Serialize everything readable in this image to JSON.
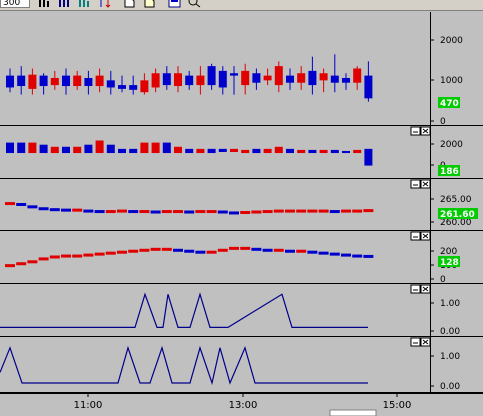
{
  "toolbar": {
    "input_value": "300",
    "buttons": [
      "bar-chart-icon",
      "volume-chart-icon",
      "stats-chart-icon",
      "sort-icon",
      "open-icon",
      "export-icon",
      "settings-icon",
      "zoom-icon"
    ]
  },
  "colors": {
    "background": "#c0c0c0",
    "up": "#e00000",
    "down": "#0000cc",
    "line": "#00008b",
    "badge": "#00cc00"
  },
  "x_axis": {
    "ticks": [
      "11:00",
      "13:00",
      "15:00"
    ]
  },
  "panels": [
    {
      "id": "price",
      "y_ticks": [
        "2000",
        "1000",
        "0"
      ],
      "badge": "470",
      "has_controls": false
    },
    {
      "id": "volume",
      "y_ticks": [
        "2000",
        "0"
      ],
      "badge": "186",
      "has_controls": true
    },
    {
      "id": "indicator1",
      "y_ticks": [
        "265.00",
        "260.00"
      ],
      "badge": "261.60",
      "has_controls": true
    },
    {
      "id": "indicator2",
      "y_ticks": [
        "200",
        "100",
        "0"
      ],
      "badge": "128",
      "has_controls": true
    },
    {
      "id": "signal1",
      "y_ticks": [
        "1.00",
        "0.00"
      ],
      "badge": "",
      "has_controls": true
    },
    {
      "id": "signal2",
      "y_ticks": [
        "1.00",
        "0.00"
      ],
      "badge": "",
      "has_controls": true
    }
  ],
  "chart_data": [
    {
      "type": "candlestick",
      "panel": "price",
      "ylim": [
        0,
        2300
      ],
      "candles": [
        {
          "o": 1000,
          "c": 750,
          "h": 1150,
          "l": 650
        },
        {
          "o": 1000,
          "c": 780,
          "h": 1200,
          "l": 600
        },
        {
          "o": 720,
          "c": 1020,
          "h": 1150,
          "l": 600
        },
        {
          "o": 1000,
          "c": 780,
          "h": 1050,
          "l": 600
        },
        {
          "o": 800,
          "c": 950,
          "h": 1100,
          "l": 700
        },
        {
          "o": 1000,
          "c": 780,
          "h": 1150,
          "l": 600
        },
        {
          "o": 780,
          "c": 1000,
          "h": 1100,
          "l": 700
        },
        {
          "o": 950,
          "c": 780,
          "h": 1100,
          "l": 600
        },
        {
          "o": 780,
          "c": 1000,
          "h": 1150,
          "l": 650
        },
        {
          "o": 900,
          "c": 750,
          "h": 1100,
          "l": 600
        },
        {
          "o": 800,
          "c": 720,
          "h": 1000,
          "l": 650
        },
        {
          "o": 800,
          "c": 700,
          "h": 1000,
          "l": 600
        },
        {
          "o": 650,
          "c": 900,
          "h": 1050,
          "l": 600
        },
        {
          "o": 750,
          "c": 1050,
          "h": 1150,
          "l": 650
        },
        {
          "o": 1050,
          "c": 800,
          "h": 1200,
          "l": 700
        },
        {
          "o": 780,
          "c": 1050,
          "h": 1200,
          "l": 650
        },
        {
          "o": 1000,
          "c": 800,
          "h": 1100,
          "l": 700
        },
        {
          "o": 800,
          "c": 1000,
          "h": 1200,
          "l": 600
        },
        {
          "o": 1200,
          "c": 800,
          "h": 1250,
          "l": 700
        },
        {
          "o": 1100,
          "c": 750,
          "h": 1200,
          "l": 600
        },
        {
          "o": 1050,
          "c": 1000,
          "h": 1200,
          "l": 600
        },
        {
          "o": 800,
          "c": 1100,
          "h": 1250,
          "l": 600
        },
        {
          "o": 1050,
          "c": 850,
          "h": 1150,
          "l": 700
        },
        {
          "o": 900,
          "c": 1000,
          "h": 1150,
          "l": 800
        },
        {
          "o": 800,
          "c": 1200,
          "h": 1300,
          "l": 650
        },
        {
          "o": 1000,
          "c": 850,
          "h": 1150,
          "l": 700
        },
        {
          "o": 850,
          "c": 1050,
          "h": 1200,
          "l": 700
        },
        {
          "o": 1100,
          "c": 800,
          "h": 1400,
          "l": 600
        },
        {
          "o": 900,
          "c": 1050,
          "h": 1150,
          "l": 650
        },
        {
          "o": 1000,
          "c": 850,
          "h": 1450,
          "l": 650
        },
        {
          "o": 950,
          "c": 850,
          "h": 1050,
          "l": 700
        },
        {
          "o": 850,
          "c": 1150,
          "h": 1200,
          "l": 700
        },
        {
          "o": 1000,
          "c": 520,
          "h": 1300,
          "l": 450
        }
      ]
    },
    {
      "type": "bar",
      "panel": "volume",
      "ylim": [
        0,
        2300
      ],
      "candles": [
        {
          "o": 1600,
          "c": 1100
        },
        {
          "o": 1600,
          "c": 1100
        },
        {
          "o": 1100,
          "c": 1600
        },
        {
          "o": 1500,
          "c": 1100
        },
        {
          "o": 1100,
          "c": 1400
        },
        {
          "o": 1400,
          "c": 1100
        },
        {
          "o": 1100,
          "c": 1400
        },
        {
          "o": 1500,
          "c": 1100
        },
        {
          "o": 1100,
          "c": 1700
        },
        {
          "o": 1500,
          "c": 1100
        },
        {
          "o": 1300,
          "c": 1100
        },
        {
          "o": 1300,
          "c": 1100
        },
        {
          "o": 1100,
          "c": 1600
        },
        {
          "o": 1100,
          "c": 1600
        },
        {
          "o": 1600,
          "c": 1100
        },
        {
          "o": 1100,
          "c": 1400
        },
        {
          "o": 1300,
          "c": 1100
        },
        {
          "o": 1100,
          "c": 1300
        },
        {
          "o": 1300,
          "c": 1100
        },
        {
          "o": 1300,
          "c": 1150
        },
        {
          "o": 1150,
          "c": 1300
        },
        {
          "o": 1100,
          "c": 1250
        },
        {
          "o": 1300,
          "c": 1100
        },
        {
          "o": 1100,
          "c": 1300
        },
        {
          "o": 1100,
          "c": 1400
        },
        {
          "o": 1300,
          "c": 1100
        },
        {
          "o": 1100,
          "c": 1250
        },
        {
          "o": 1250,
          "c": 1100
        },
        {
          "o": 1100,
          "c": 1250
        },
        {
          "o": 1250,
          "c": 1100
        },
        {
          "o": 1200,
          "c": 1100
        },
        {
          "o": 1100,
          "c": 1250
        },
        {
          "o": 1300,
          "c": 500
        }
      ]
    },
    {
      "type": "line",
      "panel": "indicator1",
      "ylim": [
        257,
        267
      ],
      "values": [
        262.2,
        262.0,
        261.5,
        261.1,
        260.9,
        260.8,
        260.8,
        260.6,
        260.5,
        260.5,
        260.6,
        260.5,
        260.5,
        260.4,
        260.5,
        260.5,
        260.4,
        260.5,
        260.5,
        260.4,
        260.2,
        260.3,
        260.4,
        260.5,
        260.6,
        260.6,
        260.6,
        260.6,
        260.6,
        260.5,
        260.6,
        260.6,
        260.7
      ]
    },
    {
      "type": "line",
      "panel": "indicator2",
      "ylim": [
        0,
        250
      ],
      "values": [
        80,
        90,
        100,
        115,
        125,
        130,
        130,
        135,
        140,
        145,
        150,
        155,
        160,
        165,
        165,
        160,
        155,
        150,
        150,
        160,
        170,
        170,
        165,
        160,
        160,
        155,
        155,
        150,
        145,
        140,
        135,
        130,
        128
      ]
    },
    {
      "type": "step",
      "panel": "signal1",
      "ylim": [
        -0.2,
        1.25
      ],
      "x": [
        0,
        135,
        145,
        157,
        163,
        168,
        178,
        190,
        200,
        210,
        218,
        228,
        282,
        292,
        302,
        368
      ],
      "values": [
        0,
        0,
        1,
        0,
        0,
        1,
        0,
        0,
        1,
        0,
        0,
        0,
        1,
        0,
        0,
        0
      ]
    },
    {
      "type": "step",
      "panel": "signal2",
      "ylim": [
        -0.2,
        1.25
      ],
      "x": [
        0,
        10,
        22,
        118,
        128,
        140,
        150,
        162,
        172,
        190,
        200,
        212,
        220,
        230,
        245,
        255,
        265,
        368
      ],
      "values": [
        0.3,
        1,
        0,
        0,
        1,
        0,
        0,
        1,
        0,
        0,
        1,
        0,
        1,
        0,
        1,
        0,
        0,
        0
      ]
    }
  ]
}
